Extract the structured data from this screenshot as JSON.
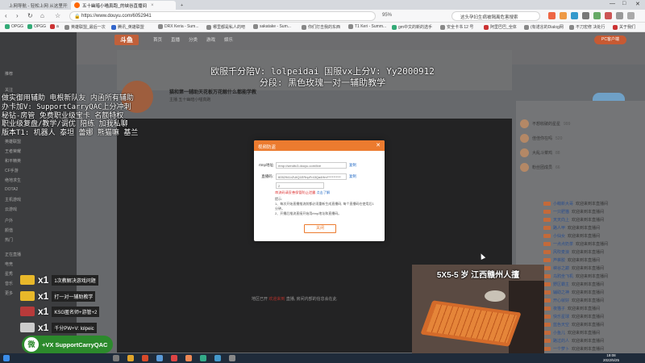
{
  "browser": {
    "tabs": [
      {
        "label": "上网导航 - 轻松上网 从这里开始",
        "active": false
      },
      {
        "label": "五十幽暗小喵真跑_的峡谷直播间",
        "active": true
      }
    ],
    "new_tab": "+",
    "url": "https://www.douyu.com/6052941",
    "zoom": "95%",
    "search": "这头孕妇生病被隔离危害搜索",
    "bookmarks": [
      "OPGG",
      "OPGG",
      "a",
      "英雄联盟_最后一次",
      "腾讯_英雄联盟",
      "DRX Keria - Sum...",
      "哪里都是私人的吧",
      "sakatake - Sum...",
      "你们打击我的东西",
      "T1 Keri - Summ...",
      "gm中文的新的选手",
      "安全卡书 12 号",
      "阿里巴巴_全体",
      "(有诺言的Dialog网",
      "不刀宏修 决处行",
      "关于我们"
    ]
  },
  "site": {
    "logo": "斗鱼",
    "nav": [
      "首页",
      "直播",
      "分类",
      "游戏",
      "娱乐"
    ],
    "user_btn": "PC客户端",
    "room_title": "猫和第一辅助天花板万花鲸什么都能学教",
    "streamer": "主播 五十幽暗小喵真跑",
    "sidebar": [
      "推荐",
      "关注",
      "英雄联盟",
      "王者荣耀",
      "和平精英",
      "CF手游",
      "绝地求生",
      "DOTA2",
      "主机游戏",
      "云游戏",
      "户外",
      "颜值",
      "热门",
      "正在直播",
      "电竞",
      "星秀",
      "音乐",
      "更多"
    ],
    "player_info": {
      "prefix": "地区已开",
      "highlight": "欢迎来到",
      "suffix": "直播, 房间内部的信息会在此"
    }
  },
  "chat": {
    "ranks": [
      {
        "name": "不想收破的星星",
        "value": "999"
      },
      {
        "name": "佳佳你在吗",
        "value": "520"
      },
      {
        "name": "大乱斗菜鸡",
        "value": "88"
      },
      {
        "name": "粉丝团成员",
        "value": "66"
      }
    ],
    "messages": [
      {
        "name": "小萌新大哥",
        "text": "欢迎来到本直播间"
      },
      {
        "name": "一只肥猫",
        "text": "欢迎来到本直播间"
      },
      {
        "name": "天天向上",
        "text": "欢迎来到本直播间"
      },
      {
        "name": "路人甲",
        "text": "欢迎来到本直播间"
      },
      {
        "name": "小仙女",
        "text": "欢迎来到本直播间"
      },
      {
        "name": "一点点奶茶",
        "text": "欢迎来到本直播间"
      },
      {
        "name": "风吹麦浪",
        "text": "欢迎来到本直播间"
      },
      {
        "name": "芦荟胶",
        "text": "欢迎来到本直播间"
      },
      {
        "name": "峡谷之巅",
        "text": "欢迎来到本直播间"
      },
      {
        "name": "乌鸦坐飞机",
        "text": "欢迎来到本直播间"
      },
      {
        "name": "野区霸主",
        "text": "欢迎来到本直播间"
      },
      {
        "name": "辅助之神",
        "text": "欢迎来到本直播间"
      },
      {
        "name": "开心就好",
        "text": "欢迎来到本直播间"
      },
      {
        "name": "夜猫子",
        "text": "欢迎来到本直播间"
      },
      {
        "name": "快乐星球",
        "text": "欢迎来到本直播间"
      },
      {
        "name": "蓝色天空",
        "text": "欢迎来到本直播间"
      },
      {
        "name": "小鱼儿",
        "text": "欢迎来到本直播间"
      },
      {
        "name": "路过的人",
        "text": "欢迎来到本直播间"
      },
      {
        "name": "一个萝卜",
        "text": "欢迎来到本直播间"
      }
    ]
  },
  "overlay": {
    "top_line1": "欧服千分陪V: lolpeidai 国服vx上分V: Yy2000912",
    "top_line2": "分段: 黑色玫瑰一对一辅助教学",
    "left_lines": [
      "做实御用辅助 电根新队友 内函所有辅助",
      "办卡加V: SupportCarryQAC上分冲刺",
      "秘钻-房管 免费职业级宝卡 名额特权",
      "职业级复盘/教学/调优 陪练 加我私聊",
      "版本T1: 机器人 泰坦 蕾娜 熊猫嘛 基兰"
    ],
    "gifts": [
      {
        "qty": "x1",
        "label": "1次教解决游戏问题",
        "color": "#e8b82a"
      },
      {
        "qty": "x1",
        "label": "打一对一辅助教学",
        "color": "#e8b82a"
      },
      {
        "qty": "x1",
        "label": "KSG匿名师+游管+2",
        "color": "#b83a3a"
      },
      {
        "qty": "x1",
        "label": "千分PW+V: lolpeic",
        "color": "#cccccc"
      }
    ],
    "wechat": "+VX SupportCarryQAC",
    "wechat_icon": "微",
    "webcam_caption": "5X5-5 岁 江西赣州人擅"
  },
  "modal": {
    "title": "视频防盗",
    "close": "✕",
    "rtmp_label": "rtmp地址:",
    "rtmp_value": "rtmp://sendtc3.douyu.com/live",
    "copy": "复制",
    "key_label": "直播码:",
    "key_value": "6052941rZUtQ1ERnpFr43Qa4Hm***********",
    "copy2": "复制",
    "select_value": "2",
    "warn": "串流码请妥善保管防止泄露",
    "warn_link": "点击了解",
    "tips": "提示:\n1、每次开始直播推流前都必须重新生成直播码, 每个直播码在使用后1分钟。\n2、开播后推流直接开始用rtmp地址和直播码。",
    "btn": "关闭"
  },
  "taskbar": {
    "time": "19:08",
    "date": "2022/5/25"
  }
}
